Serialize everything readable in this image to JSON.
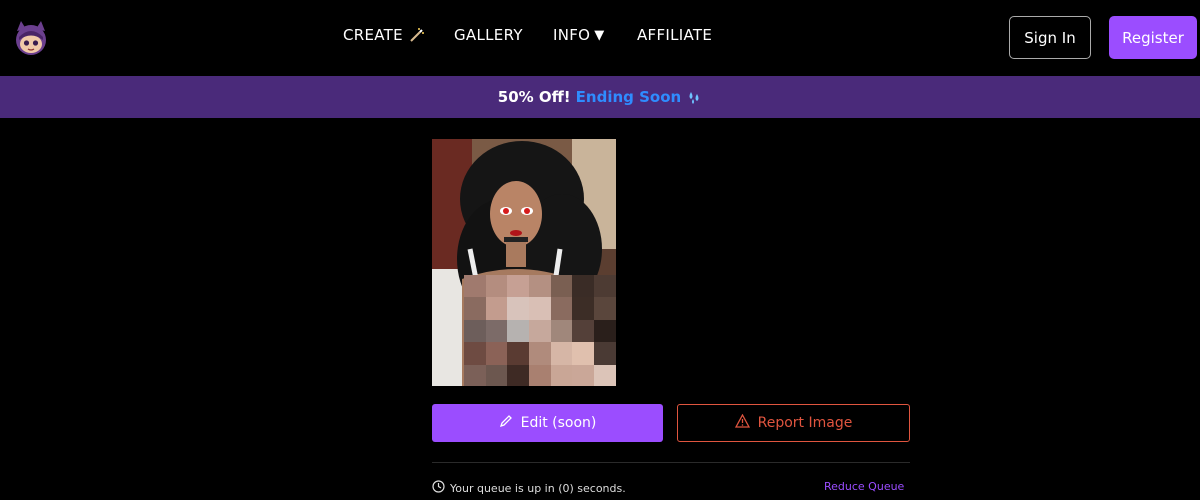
{
  "nav": {
    "create": "CREATE",
    "gallery": "GALLERY",
    "info": "INFO",
    "affiliate": "AFFILIATE",
    "signin": "Sign In",
    "register": "Register"
  },
  "promo": {
    "offer": "50% Off!",
    "ending": "Ending Soon"
  },
  "actions": {
    "edit": "Edit (soon)",
    "report": "Report Image"
  },
  "queue": {
    "status": "Your queue is up in (0) seconds.",
    "reduce": "Reduce Queue"
  },
  "colors": {
    "accent": "#9b4dff",
    "promo_bg": "#4a2a7a",
    "promo_highlight": "#2f8cff",
    "report": "#e0553f"
  },
  "icons": {
    "create": "magic-wand-icon",
    "info": "caret-down-icon",
    "promo": "water-drops-icon",
    "edit": "pencil-icon",
    "report": "warning-triangle-icon",
    "queue": "clock-icon"
  }
}
